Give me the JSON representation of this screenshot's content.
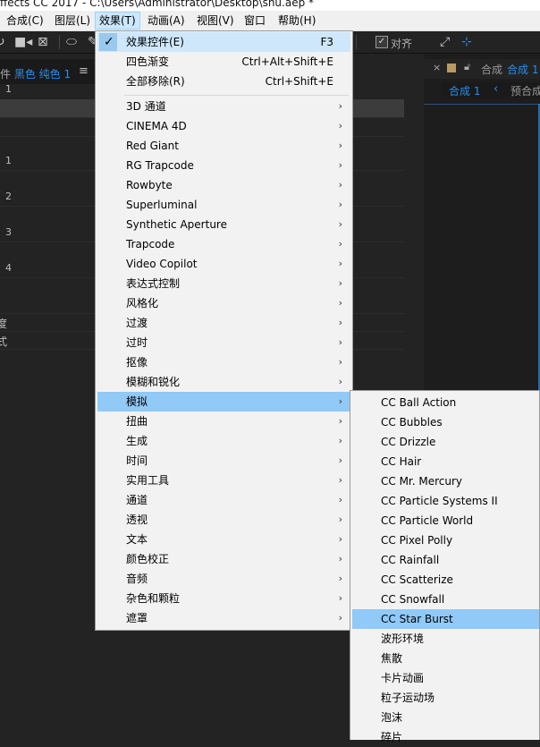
{
  "window": {
    "title": "ffects CC 2017 - C:\\Users\\Administrator\\Desktop\\shu.aep *"
  },
  "menubar": {
    "items": [
      "合成(C)",
      "图层(L)",
      "效果(T)",
      "动画(A)",
      "视图(V)",
      "窗口",
      "帮助(H)"
    ],
    "active": "效果(T)"
  },
  "toolbar": {
    "align_label": "对齐",
    "align_checked": true
  },
  "left_panel": {
    "tab_prefix": "件",
    "tab_name": "黑色 纯色 1",
    "rows": [
      {
        "num": "1",
        "text": ""
      },
      {
        "num": "",
        "text": ""
      },
      {
        "num": "",
        "text": ""
      },
      {
        "num": "1",
        "text": ""
      },
      {
        "num": "2",
        "text": ""
      },
      {
        "num": "3",
        "text": ""
      },
      {
        "num": "4",
        "text": ""
      },
      {
        "num": "",
        "text": ""
      },
      {
        "num": "",
        "text": "度"
      },
      {
        "num": "",
        "text": "式"
      }
    ]
  },
  "right_panel": {
    "tab_label": "合成",
    "tab_active": "合成 1",
    "sub_active": "合成 1",
    "sub_other": "预合成"
  },
  "effects_menu": {
    "top_items": [
      {
        "label": "效果控件(E)",
        "shortcut": "F3",
        "checked": true
      },
      {
        "label": "四色渐变",
        "shortcut": "Ctrl+Alt+Shift+E"
      },
      {
        "label": "全部移除(R)",
        "shortcut": "Ctrl+Shift+E"
      }
    ],
    "categories": [
      "3D 通道",
      "CINEMA 4D",
      "Red Giant",
      "RG Trapcode",
      "Rowbyte",
      "Superluminal",
      "Synthetic Aperture",
      "Trapcode",
      "Video Copilot",
      "表达式控制",
      "风格化",
      "过渡",
      "过时",
      "抠像",
      "模糊和锐化",
      "模拟",
      "扭曲",
      "生成",
      "时间",
      "实用工具",
      "通道",
      "透视",
      "文本",
      "颜色校正",
      "音频",
      "杂色和颗粒",
      "遮罩"
    ],
    "highlighted": "模拟",
    "submenu_arrow": "›"
  },
  "simulation_submenu": {
    "items": [
      "CC Ball Action",
      "CC Bubbles",
      "CC Drizzle",
      "CC Hair",
      "CC Mr. Mercury",
      "CC Particle Systems II",
      "CC Particle World",
      "CC Pixel Polly",
      "CC Rainfall",
      "CC Scatterize",
      "CC Snowfall",
      "CC Star Burst",
      "波形环境",
      "焦散",
      "卡片动画",
      "粒子运动场",
      "泡沫",
      "碎片"
    ],
    "highlighted": "CC Star Burst"
  },
  "colors": {
    "accent_blue": "#2d8ceb",
    "menu_highlight": "#91c9f7",
    "menu_bg": "#f2f2f2",
    "app_bg": "#232323"
  }
}
